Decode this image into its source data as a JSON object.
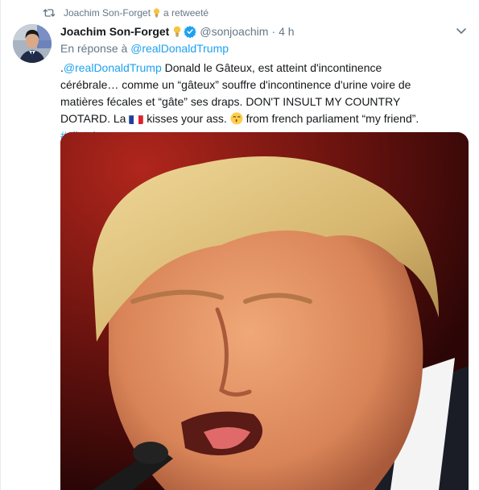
{
  "retweet_context": {
    "user": "Joachim Son-Forget",
    "action": "a retweeté"
  },
  "tweet": {
    "display_name": "Joachim Son-Forget",
    "handle": "@sonjoachim",
    "separator": "·",
    "time": "4 h",
    "reply_prefix": "En réponse à",
    "reply_handle": "@realDonaldTrump",
    "text": {
      "lead": ".",
      "mention": "@realDonaldTrump",
      "part1": " Donald le Gâteux, est atteint d'incontinence cérébrale… comme un “gâteux” souffre d'incontinence d'urine voire de matières fécales et “gâte” ses draps. DON'T INSULT MY COUNTRY DOTARD. La ",
      "part2": " kisses your ass. ",
      "part3": " from french parliament “my friend”. ",
      "hashtag": "#giletsjaunes"
    },
    "media_alt": ""
  },
  "icons": {
    "retweet": "retweet-icon",
    "bulb": "lightbulb-icon",
    "verified": "verified-badge-icon",
    "caret": "chevron-down-icon",
    "flag": "france-flag-icon",
    "emoji": "kissing-face-icon"
  },
  "colors": {
    "link": "#1da1f2",
    "secondary_text": "#657786",
    "primary_text": "#14171a",
    "verified": "#1da1f2",
    "retweet_icon": "#657786"
  }
}
